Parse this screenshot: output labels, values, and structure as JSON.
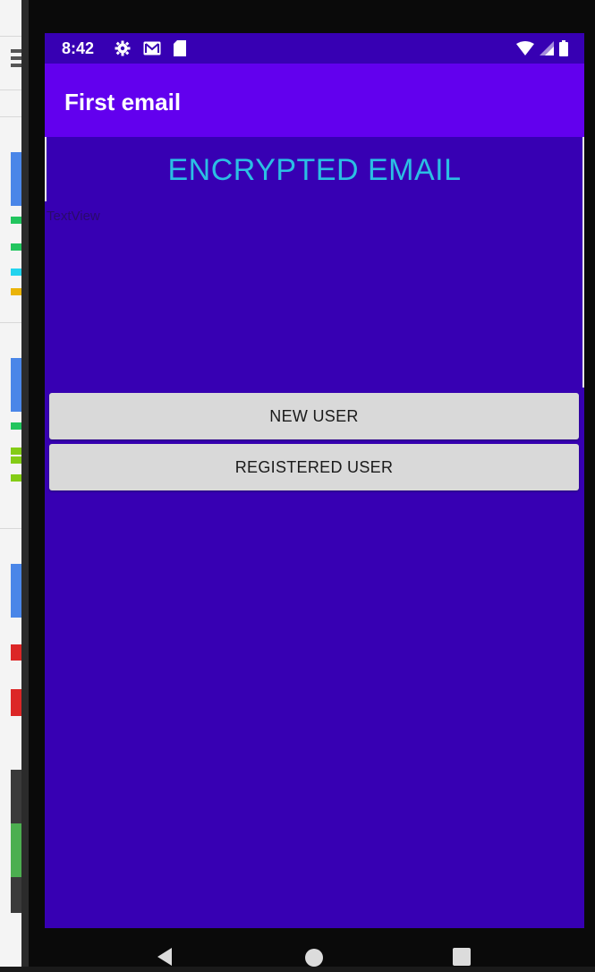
{
  "status_bar": {
    "time": "8:42",
    "left_icons": [
      "settings-icon",
      "gmail-icon",
      "sd-card-icon"
    ],
    "right_icons": [
      "wifi-icon",
      "signal-icon",
      "battery-icon"
    ]
  },
  "app_bar": {
    "title": "First email"
  },
  "main": {
    "heading": "ENCRYPTED EMAIL",
    "textview": "TextView",
    "buttons": {
      "new_user": "NEW USER",
      "registered_user": "REGISTERED USER"
    }
  },
  "nav_bar": {
    "buttons": [
      "back-icon",
      "home-icon",
      "recents-icon"
    ]
  },
  "colors": {
    "status_bar": "#3700b3",
    "app_bar": "#6200ee",
    "background": "#3700b3",
    "heading": "#2bbfe3",
    "button": "#d9d9d9"
  }
}
